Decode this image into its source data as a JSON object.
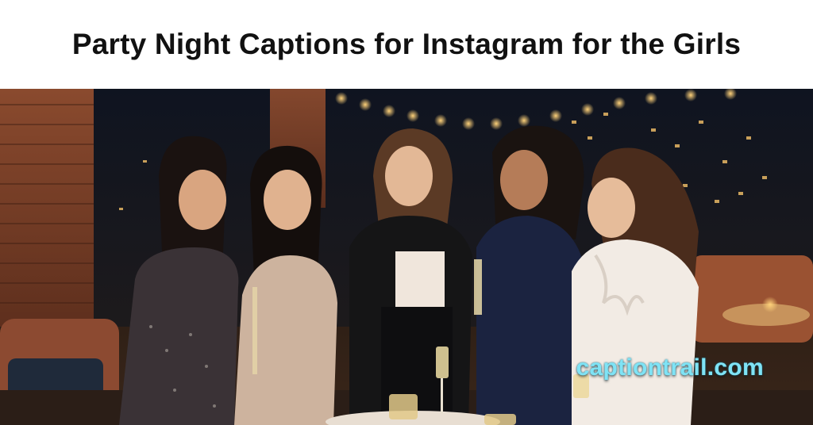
{
  "header": {
    "title": "Party Night Captions for Instagram for the Girls"
  },
  "photo": {
    "subject": "party-photo"
  },
  "watermark": {
    "text": "captiontrail.com"
  },
  "colors": {
    "title": "#111111",
    "watermark": "#7fe3f5"
  }
}
